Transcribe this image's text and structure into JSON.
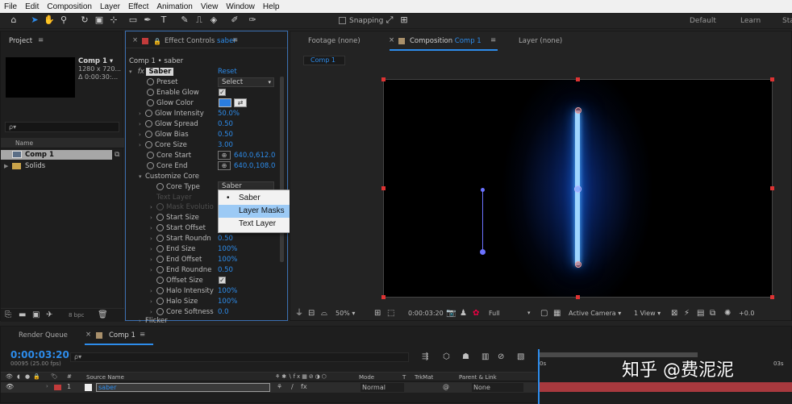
{
  "menu": [
    "File",
    "Edit",
    "Composition",
    "Layer",
    "Effect",
    "Animation",
    "View",
    "Window",
    "Help"
  ],
  "toolbar": {
    "snapping": "Snapping",
    "workspaces": [
      "Default",
      "Learn",
      "Stan"
    ]
  },
  "project": {
    "title": "Project",
    "comp_name": "Comp 1 ▾",
    "comp_size": "1280 x 720...",
    "comp_duration": "Δ 0:00:30:...",
    "search_placeholder": "ρ▾",
    "col_name": "Name",
    "items": [
      "Comp 1",
      "Solids"
    ],
    "bpc": "8 bpc"
  },
  "effects": {
    "tab_prefix": "Effect Controls",
    "tab_layer": "saber",
    "breadcrumb": "Comp 1 • saber",
    "fx_label": "fx",
    "effect_name": "Saber",
    "reset": "Reset",
    "props": [
      {
        "name": "Preset",
        "value": "Select"
      },
      {
        "name": "Enable Glow",
        "value": "✓"
      },
      {
        "name": "Glow Color",
        "value": ""
      },
      {
        "name": "Glow Intensity",
        "value": "50.0%"
      },
      {
        "name": "Glow Spread",
        "value": "0.50"
      },
      {
        "name": "Glow Bias",
        "value": "0.50"
      },
      {
        "name": "Core Size",
        "value": "3.00"
      },
      {
        "name": "Core Start",
        "value": "640.0,612.0"
      },
      {
        "name": "Core End",
        "value": "640.0,108.0"
      },
      {
        "name": "Customize Core",
        "value": ""
      },
      {
        "name": "Core Type",
        "value": "Saber"
      },
      {
        "name": "Text Layer",
        "value": ""
      },
      {
        "name": "Mask Evolutio",
        "value": ""
      },
      {
        "name": "Start Size",
        "value": ""
      },
      {
        "name": "Start Offset",
        "value": ""
      },
      {
        "name": "Start Roundn",
        "value": "0.50"
      },
      {
        "name": "End Size",
        "value": "100%"
      },
      {
        "name": "End Offset",
        "value": "100%"
      },
      {
        "name": "End Roundne",
        "value": "0.50"
      },
      {
        "name": "Offset Size",
        "value": "✓"
      },
      {
        "name": "Halo Intensity",
        "value": "100%"
      },
      {
        "name": "Halo Size",
        "value": "100%"
      },
      {
        "name": "Core Softness",
        "value": "0.0"
      },
      {
        "name": "Flicker",
        "value": ""
      }
    ],
    "popup": [
      "Saber",
      "Layer Masks",
      "Text Layer"
    ]
  },
  "composition": {
    "footage_tab": "Footage (none)",
    "comp_tab_prefix": "Composition",
    "comp_tab_name": "Comp 1",
    "layer_tab": "Layer (none)",
    "sub_tab": "Comp 1",
    "zoom": "50%",
    "timecode": "0:00:03:20",
    "resolution": "Full",
    "camera": "Active Camera",
    "views": "1 View",
    "exposure": "+0.0"
  },
  "timeline": {
    "render_queue": "Render Queue",
    "comp_tab": "Comp 1",
    "timecode": "0:00:03:20",
    "frames": "00095 (25.00 fps)",
    "search": "ρ▾",
    "cols": {
      "source": "Source Name",
      "mode": "Mode",
      "t": "T",
      "trkmat": "TrkMat",
      "parent": "Parent & Link"
    },
    "layer": {
      "num": "1",
      "name": "saber",
      "mode": "Normal",
      "parent": "None"
    },
    "ruler": [
      "0s",
      "03s"
    ],
    "watermark": "知乎 @费泥泥"
  },
  "colors": {
    "accent": "#2d8ceb",
    "saber": "#3aa0ff"
  }
}
